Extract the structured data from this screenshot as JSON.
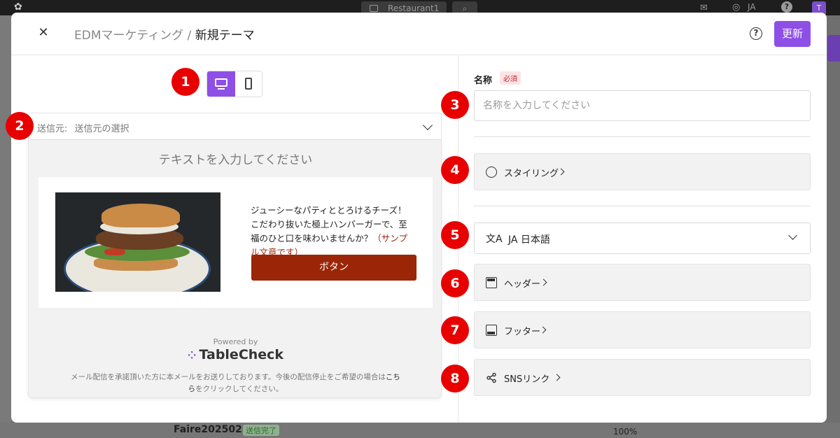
{
  "appbar": {
    "venue": "Restaurant1",
    "lang": "JA",
    "avatar_initial": "T"
  },
  "background": {
    "row_name": "Faire202502",
    "row_badge": "送信完了",
    "row_pct": "100%"
  },
  "header": {
    "breadcrumb_parent": "EDMマーケティング",
    "breadcrumb_sep": "/",
    "breadcrumb_current": "新規テーマ",
    "help": "?",
    "update_label": "更新"
  },
  "markers": [
    "1",
    "2",
    "3",
    "4",
    "5",
    "6",
    "7",
    "8"
  ],
  "sender": {
    "label": "送信元:",
    "value": "送信元の選択"
  },
  "preview": {
    "title_placeholder": "テキストを入力してください",
    "description": "ジューシーなパティととろけるチーズ！こだわり抜いた極上ハンバーガーで、至福のひと口を味わいませんか？",
    "description_sample": "（サンプル文章です）",
    "button_label": "ボタン",
    "powered_by": "Powered by",
    "brand": "TableCheck",
    "footer_text": "メール配信を承諾頂いた方に本メールをお送りしております。今後の配信停止をご希望の場合は",
    "footer_link": "こちら",
    "footer_tail": "をクリックしてください。"
  },
  "settings": {
    "name_label": "名称",
    "required_badge": "必須",
    "name_placeholder": "名称を入力してください",
    "styling_label": "スタイリング",
    "language_value": "JA 日本語",
    "header_label": "ヘッダー",
    "footer_label": "フッター",
    "sns_label": "SNSリンク"
  },
  "colors": {
    "accent": "#8e4fe6",
    "cta": "#9b2507",
    "marker": "#e80000"
  }
}
